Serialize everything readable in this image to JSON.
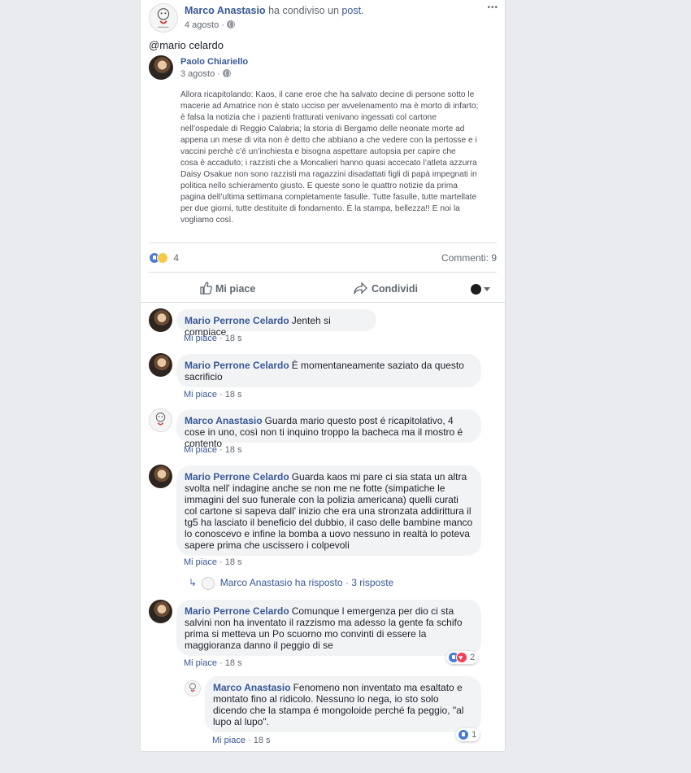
{
  "post": {
    "author": "Marco Anastasio",
    "shared_text": "ha condiviso un",
    "shared_link": "post",
    "shared_end": ".",
    "date": "4 agosto",
    "sep": "·",
    "more_icon": "•••",
    "mention": "@mario celardo",
    "shared": {
      "author": "Paolo Chiariello",
      "date": "3 agosto",
      "body_lines": [
        "Allora ricapitolando: Kaos, il cane eroe che ha salvato decine di persone sotto le",
        "macerie ad Amatrice non è stato ucciso per avvelenamento ma è morto di infarto;",
        "è falsa la notizia che i pazienti fratturati venivano ingessati col cartone",
        "nell’ospedale di Reggio Calabria; la storia di Bergamo delle neonate morte ad",
        "appena un mese di vita non è detto che abbiano a che vedere con la pertosse e i",
        "vaccini perchè c’è un’inchiesta e bisogna aspettare autopsia per capire che",
        "cosa è accaduto; i razzisti che a Moncalieri hanno quasi accecato l’atleta azzurra",
        "Daisy Osakue non sono razzisti ma ragazzini disadattati figli di papà impegnati in",
        "politica nello schieramento giusto. E queste sono le quattro notizie da prima",
        "pagina dell’ultima settimana completamente fasulle. Tutte fasulle, tutte martellate",
        "per due giorni, tutte destituite di fondamento. È la stampa, bellezza!! E noi la",
        "vogliamo così."
      ]
    },
    "reaction_count": "4",
    "comments_count": "Commenti: 9",
    "actions": {
      "like": "Mi piace",
      "share": "Condividi"
    }
  },
  "comments": [
    {
      "name": "Mario Perrone Celardo",
      "text": "Jenteh si compiace",
      "like": "Mi piace",
      "time": "18 s"
    },
    {
      "name": "Mario Perrone Celardo",
      "text": "È momentaneamente saziato da questo sacrificio",
      "like": "Mi piace",
      "time": "18 s"
    },
    {
      "name": "Marco Anastasio",
      "text": "Guarda mario questo post é ricapitolativo, 4 cose in uno, così non ti inquino troppo la bacheca ma il mostro é contento",
      "like": "Mi piace",
      "time": "18 s"
    },
    {
      "name": "Mario Perrone Celardo",
      "text": "Guarda kaos mi pare ci sia stata un altra svolta nell' indagine anche se non me ne fotte (simpatiche le immagini del suo funerale con la polizia americana) quelli curati col cartone si sapeva dall' inizio che era una stronzata addirittura il tg5 ha lasciato il beneficio del dubbio, il caso delle bambine manco lo conoscevo e infine la bomba a uovo nessuno in realtà lo poteva sapere prima che uscissero i colpevoli",
      "like": "Mi piace",
      "time": "18 s"
    },
    {
      "name": "Mario Perrone Celardo",
      "text": "Comunque l emergenza per dio ci sta salvini non ha inventato il razzismo ma adesso la gente fa schifo prima si metteva un Po scuorno mo convinti di essere la maggioranza danno il peggio di se",
      "like": "Mi piace",
      "time": "18 s",
      "reactions": "2"
    }
  ],
  "reply_summary": {
    "text": "Marco Anastasio ha risposto",
    "sep": "·",
    "count": "3 risposte"
  },
  "reply": {
    "name": "Marco Anastasio",
    "text": "Fenomeno non inventato ma esaltato e montato fino al ridicolo. Nessuno lo nega, io sto solo dicendo che la stampa é mongoloide perché fa peggio, \"al lupo al lupo\".",
    "like": "Mi piace",
    "time": "18 s",
    "reactions": "1"
  },
  "colors": {
    "link": "#385898",
    "background": "#e9ebee",
    "bubble": "#f2f3f5"
  }
}
